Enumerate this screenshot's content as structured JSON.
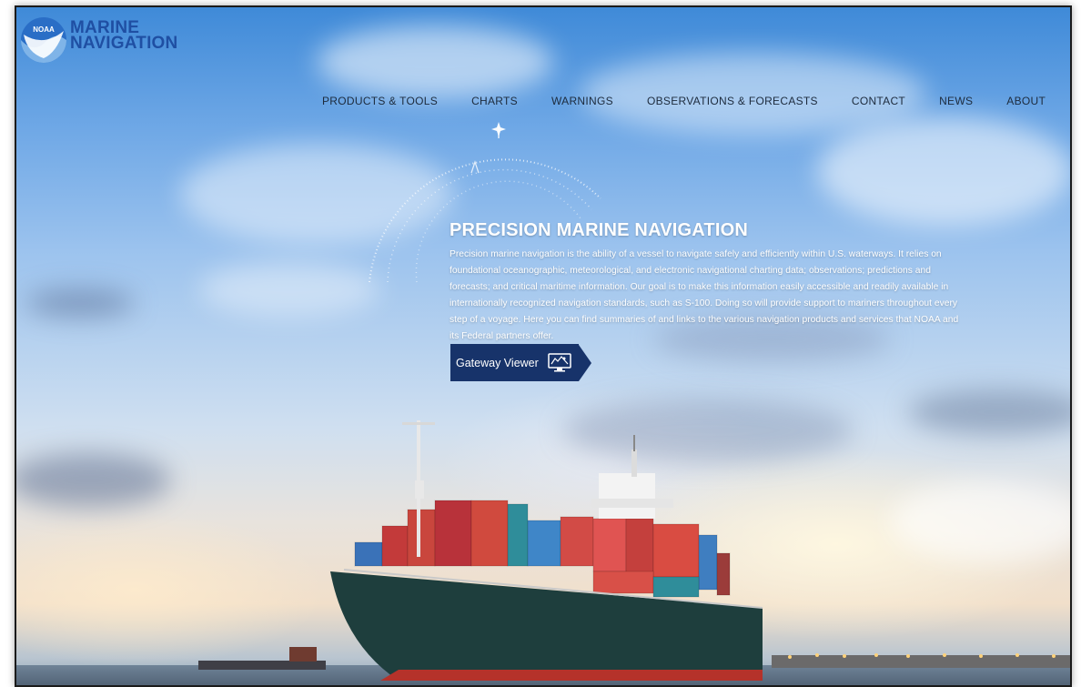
{
  "logo": {
    "badge": "NOAA",
    "line1": "MARINE",
    "line2": "NAVIGATION"
  },
  "nav": [
    {
      "label": "PRODUCTS & TOOLS"
    },
    {
      "label": "CHARTS"
    },
    {
      "label": "WARNINGS"
    },
    {
      "label": "OBSERVATIONS & FORECASTS"
    },
    {
      "label": "CONTACT"
    },
    {
      "label": "NEWS"
    },
    {
      "label": "ABOUT"
    }
  ],
  "hero": {
    "title": "PRECISION MARINE NAVIGATION",
    "description": "Precision marine navigation is the ability of a vessel to navigate safely and efficiently within U.S. waterways. It relies on foundational oceanographic, meteorological, and electronic navigational charting data; observations; predictions and forecasts; and critical maritime information. Our goal is to make this information easily accessible and readily available in internationally recognized navigation standards, such as S-100. Doing so will provide support to mariners throughout every step of a voyage. Here you can find summaries of and links to the various navigation products and services that NOAA and its Federal partners offer.",
    "button_label": "Gateway Viewer",
    "button_icon": "monitor-map-icon"
  },
  "colors": {
    "brand_blue": "#1f4fa3",
    "button_navy": "#17336a",
    "nav_text": "#1d2b3d"
  }
}
